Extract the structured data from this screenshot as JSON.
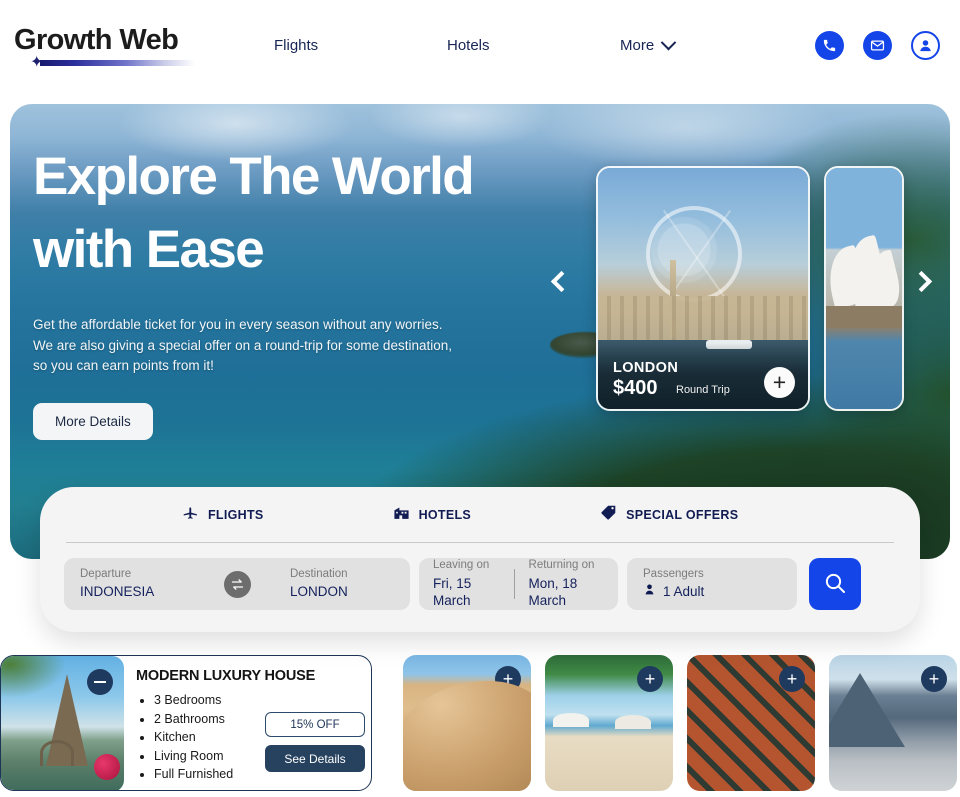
{
  "brand": {
    "name": "Growth Web",
    "logo_icon": "star-sparkle-icon"
  },
  "nav": {
    "items": [
      {
        "label": "Flights",
        "icon": null
      },
      {
        "label": "Hotels",
        "icon": null
      },
      {
        "label": "More",
        "icon": "chevron-down-icon"
      }
    ],
    "actions": [
      {
        "icon": "phone-icon"
      },
      {
        "icon": "envelope-icon"
      },
      {
        "icon": "account-icon"
      }
    ]
  },
  "hero": {
    "title_line1": "Explore The World",
    "title_line2": "with Ease",
    "subtitle_line1": "Get the affordable ticket for you in every season without any worries.",
    "subtitle_line2": "We are also giving a special offer on a round-trip for some destination,",
    "subtitle_line3": "so you can earn points from it!",
    "cta_label": "More Details",
    "prev_arrow": "chevron-left-icon",
    "next_arrow": "chevron-right-icon",
    "cards": [
      {
        "city": "LONDON",
        "price": "$400",
        "trip": "Round Trip",
        "add_icon": "plus-icon"
      },
      {
        "city": "",
        "price": "",
        "trip": "",
        "add_icon": "plus-icon"
      }
    ]
  },
  "booking": {
    "tabs": [
      {
        "label": "FLIGHTS",
        "icon": "airplane-icon",
        "active": true
      },
      {
        "label": "HOTELS",
        "icon": "hotel-icon",
        "active": false
      },
      {
        "label": "SPECIAL OFFERS",
        "icon": "tag-icon",
        "active": false
      }
    ],
    "departure": {
      "label": "Departure",
      "value": "INDONESIA"
    },
    "destination": {
      "label": "Destination",
      "value": "LONDON"
    },
    "swap_icon": "swap-arrows-icon",
    "leaving": {
      "label": "Leaving on",
      "value": "Fri, 15 March"
    },
    "returning": {
      "label": "Returning on",
      "value": "Mon, 18 March"
    },
    "passengers": {
      "label": "Passengers",
      "value": "1 Adult",
      "icon": "person-icon"
    },
    "search_icon": "search-icon"
  },
  "listing": {
    "title": "MODERN LUXURY HOUSE",
    "features": [
      "3 Bedrooms",
      "2 Bathrooms",
      "Kitchen",
      "Living Room",
      "Full Furnished"
    ],
    "discount_label": "15% OFF",
    "details_label": "See Details",
    "collapse_icon": "minus-icon",
    "photo_alt": "eiffel-tower-photo"
  },
  "thumbnails": [
    {
      "name": "desert-dunes-thumbnail",
      "add_icon": "plus-icon"
    },
    {
      "name": "tropical-beach-thumbnail",
      "add_icon": "plus-icon"
    },
    {
      "name": "aerial-city-thumbnail",
      "add_icon": "plus-icon"
    },
    {
      "name": "snowy-mountain-thumbnail",
      "add_icon": "plus-icon"
    }
  ],
  "colors": {
    "accent_blue": "#1445e8",
    "navy": "#172554",
    "dark_navy": "#27425f",
    "panel_bg": "#f4f4f4",
    "field_bg": "#e1e1e1"
  }
}
